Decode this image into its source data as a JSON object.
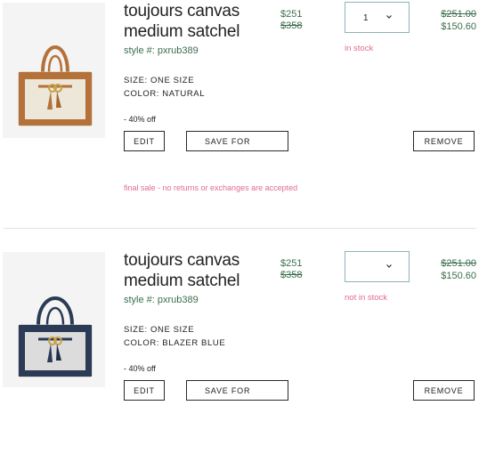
{
  "colors": {
    "price_green": "#3b6e4c",
    "alert_pink": "#e06c8f",
    "qty_border": "#8fb2b8"
  },
  "items": [
    {
      "title": "toujours canvas medium satchel",
      "style": "style #: pxrub389",
      "size": "SIZE: ONE SIZE",
      "color": "COLOR: NATURAL",
      "discount": "- 40% off",
      "edit_label": "EDIT",
      "save_label": "SAVE FOR",
      "remove_label": "REMOVE",
      "price_now": "$251",
      "price_was": "$358",
      "quantity": "1",
      "stock": "in stock",
      "total_was": "$251.00",
      "total_now": "$150.60",
      "notice": "final sale - no returns or exchanges are accepted",
      "image_icon": "natural-canvas-satchel"
    },
    {
      "title": "toujours canvas medium satchel",
      "style": "style #: pxrub389",
      "size": "SIZE: ONE SIZE",
      "color": "COLOR: BLAZER BLUE",
      "discount": "- 40% off",
      "edit_label": "EDIT",
      "save_label": "SAVE FOR",
      "remove_label": "REMOVE",
      "price_now": "$251",
      "price_was": "$358",
      "quantity": "",
      "stock": "not in stock",
      "total_was": "$251.00",
      "total_now": "$150.60",
      "image_icon": "blazer-blue-canvas-satchel"
    }
  ]
}
